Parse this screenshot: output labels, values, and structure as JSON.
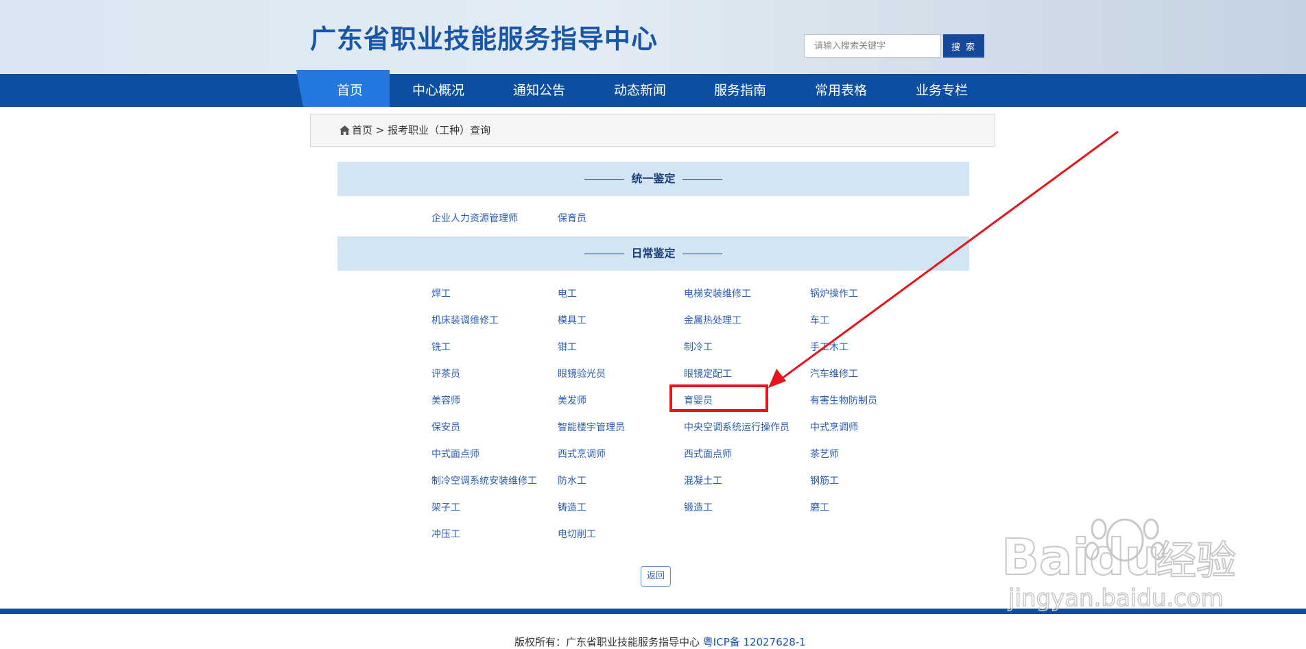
{
  "header": {
    "title": "广东省职业技能服务指导中心",
    "search_placeholder": "请输入搜索关键字",
    "search_button": "搜 索"
  },
  "nav": {
    "items": [
      "首页",
      "中心概况",
      "通知公告",
      "动态新闻",
      "服务指南",
      "常用表格",
      "业务专栏"
    ],
    "active": "首页"
  },
  "breadcrumb": {
    "home": "首页",
    "separator": ">",
    "current": "报考职业（工种）查询"
  },
  "sections": {
    "unified": {
      "title": "统一鉴定",
      "items": [
        "企业人力资源管理师",
        "保育员"
      ]
    },
    "daily": {
      "title": "日常鉴定",
      "items": [
        "焊工",
        "电工",
        "电梯安装维修工",
        "锅炉操作工",
        "机床装调维修工",
        "模具工",
        "金属热处理工",
        "车工",
        "铣工",
        "钳工",
        "制冷工",
        "手工木工",
        "评茶员",
        "眼镜验光员",
        "眼镜定配工",
        "汽车维修工",
        "美容师",
        "美发师",
        "育婴员",
        "有害生物防制员",
        "保安员",
        "智能楼宇管理员",
        "中央空调系统运行操作员",
        "中式烹调师",
        "中式面点师",
        "西式烹调师",
        "西式面点师",
        "茶艺师",
        "制冷空调系统安装维修工",
        "防水工",
        "混凝土工",
        "钢筋工",
        "架子工",
        "铸造工",
        "锻造工",
        "磨工",
        "冲压工",
        "电切削工"
      ]
    }
  },
  "return_button": "返回",
  "footer": {
    "copyright": "版权所有：广东省职业技能服务指导中心",
    "icp": "粤ICP备 12027628-1"
  },
  "annotation": {
    "highlighted_item": "育婴员",
    "color": "#e8141c"
  },
  "watermark": {
    "brand": "Baidu",
    "suffix": "经验",
    "url": "jingyan.baidu.com"
  },
  "colors": {
    "nav": "#0c4ea2",
    "nav_active": "#2478e0",
    "link": "#2a5db4",
    "section_bg": "#d3e5f2"
  }
}
